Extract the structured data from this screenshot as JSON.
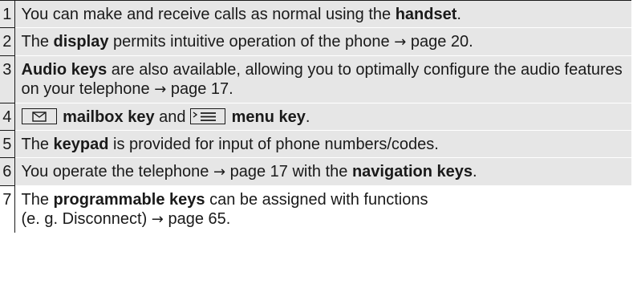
{
  "rows": [
    {
      "num": "1",
      "t1": "You can make and receive calls as normal using the ",
      "b1": "handset",
      "t2": "."
    },
    {
      "num": "2",
      "t1": "The ",
      "b1": "display",
      "t2": " permits intuitive operation of the phone ",
      "arrow": "→",
      "t3": " page 20."
    },
    {
      "num": "3",
      "b1": "Audio keys",
      "t1": " are also available, allowing you to optimally configure the audio features on your telephone ",
      "arrow": "→",
      "t2": " page 17."
    },
    {
      "num": "4",
      "mailbox_icon": "mailbox-key-icon",
      "b1": "mailbox key",
      "t1": " and ",
      "menu_icon": "menu-key-icon",
      "b2": "menu key",
      "t2": "."
    },
    {
      "num": "5",
      "t1": "The ",
      "b1": "keypad",
      "t2": " is provided for input of phone numbers/codes."
    },
    {
      "num": "6",
      "t1": "You operate the telephone ",
      "arrow": "→",
      "t2": " page 17 with the ",
      "b1": "navigation keys",
      "t3": "."
    },
    {
      "num": "7",
      "t1": "The ",
      "b1": "programmable keys",
      "t2": " can be assigned with functions",
      "t3": "(e. g. Disconnect) ",
      "arrow": "→",
      "t4": " page 65."
    }
  ]
}
